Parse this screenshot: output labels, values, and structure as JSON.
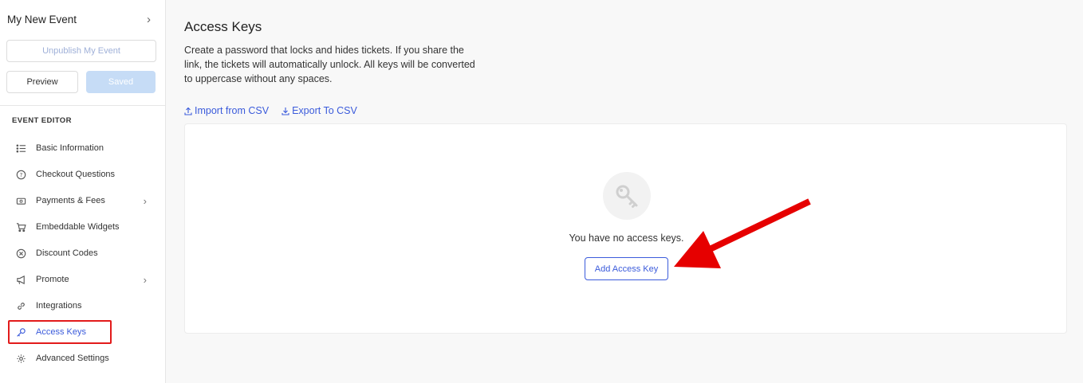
{
  "sidebar": {
    "event_name": "My New Event",
    "unpublish_label": "Unpublish My Event",
    "preview_label": "Preview",
    "saved_label": "Saved",
    "section_title": "EVENT EDITOR",
    "items": [
      {
        "label": "Basic Information",
        "icon": "list-icon"
      },
      {
        "label": "Checkout Questions",
        "icon": "question-circle-icon"
      },
      {
        "label": "Payments & Fees",
        "icon": "payment-icon",
        "has_submenu": true
      },
      {
        "label": "Embeddable Widgets",
        "icon": "cart-icon"
      },
      {
        "label": "Discount Codes",
        "icon": "discount-icon"
      },
      {
        "label": "Promote",
        "icon": "megaphone-icon",
        "has_submenu": true
      },
      {
        "label": "Integrations",
        "icon": "link-icon"
      },
      {
        "label": "Access Keys",
        "icon": "key-icon",
        "active": true
      },
      {
        "label": "Advanced Settings",
        "icon": "gear-icon"
      }
    ]
  },
  "main": {
    "title": "Access Keys",
    "description": "Create a password that locks and hides tickets. If you share the link, the tickets will automatically unlock. All keys will be converted to uppercase without any spaces.",
    "import_label": "Import from CSV",
    "export_label": "Export To CSV",
    "empty_text": "You have no access keys.",
    "add_label": "Add Access Key"
  },
  "colors": {
    "accent": "#3b5bdb",
    "highlight": "#e21b1b",
    "arrow": "#e60000"
  }
}
